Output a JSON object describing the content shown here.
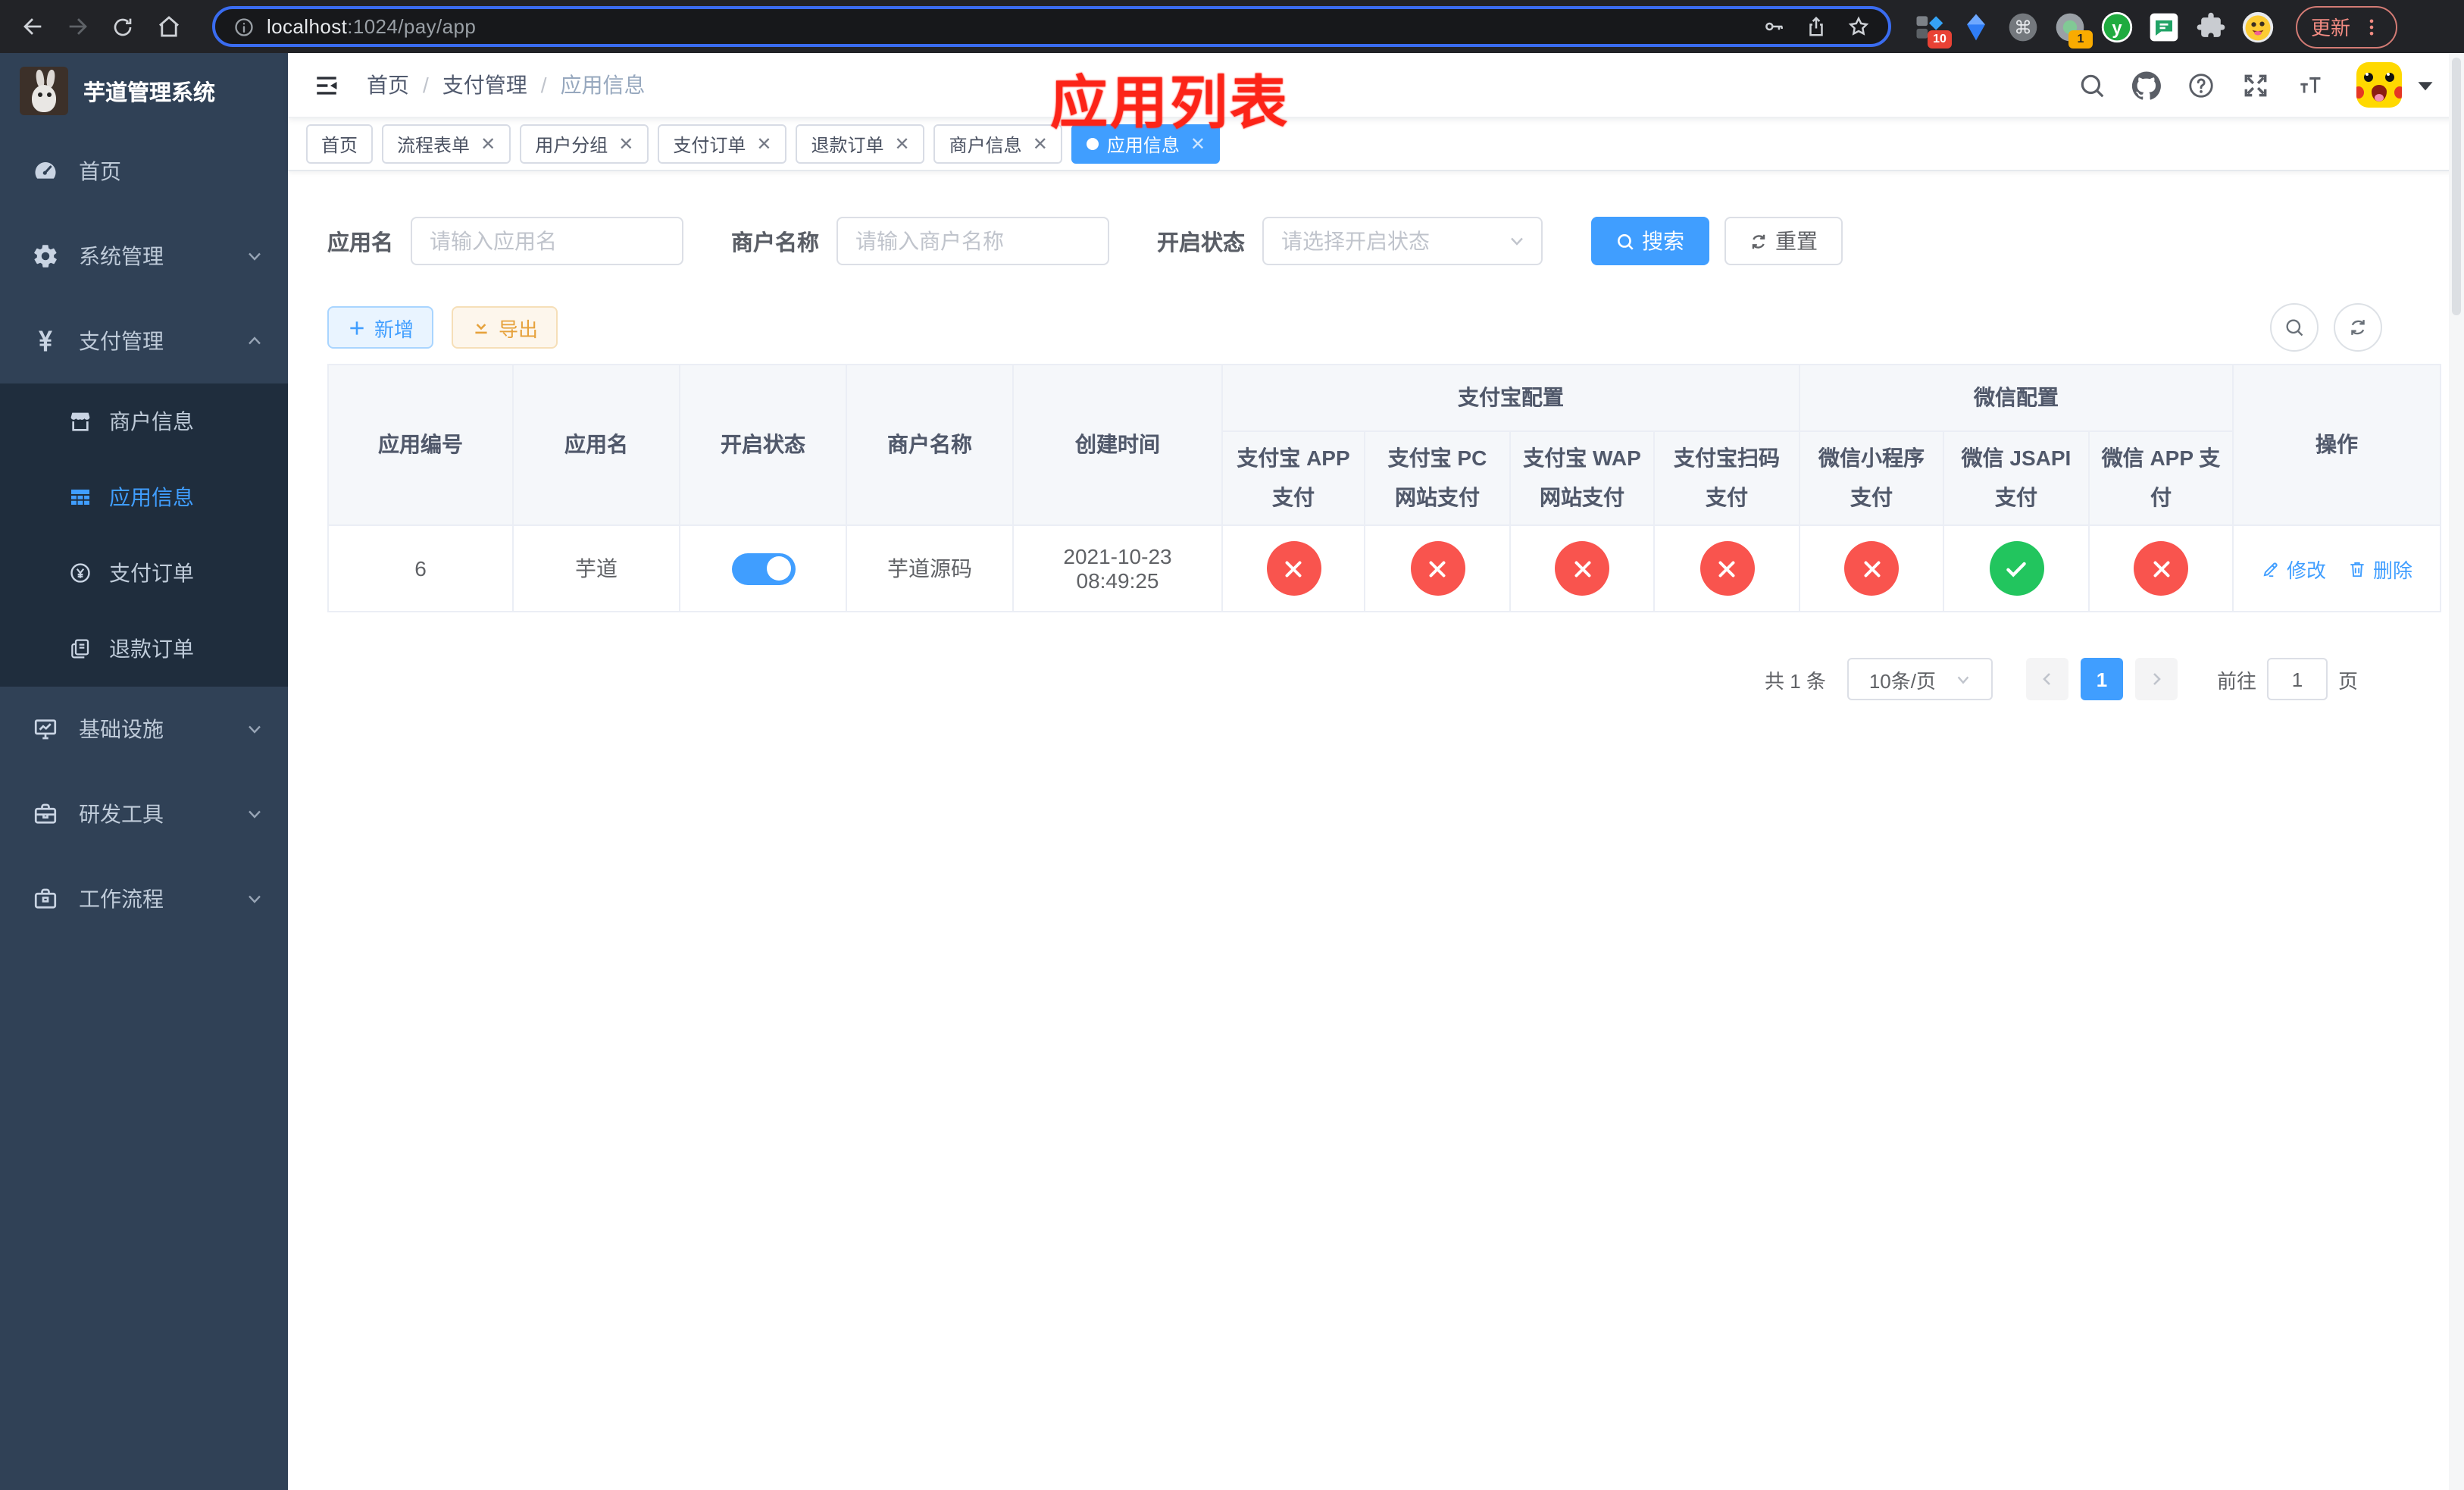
{
  "browser": {
    "url_host": "localhost",
    "url_rest": ":1024/pay/app",
    "update_label": "更新",
    "ext_badges": {
      "first": "10",
      "second": "1"
    },
    "ext5_letter": "y"
  },
  "sidebar": {
    "title": "芋道管理系统",
    "items": [
      {
        "label": "首页",
        "icon": "dashboard-icon"
      },
      {
        "label": "系统管理",
        "icon": "gear-icon",
        "chevron": "down"
      },
      {
        "label": "支付管理",
        "icon": "yen-icon",
        "chevron": "up",
        "expanded": true,
        "children": [
          {
            "label": "商户信息",
            "icon": "shop-icon"
          },
          {
            "label": "应用信息",
            "icon": "grid-icon",
            "active": true
          },
          {
            "label": "支付订单",
            "icon": "coin-icon"
          },
          {
            "label": "退款订单",
            "icon": "doc-icon"
          }
        ]
      },
      {
        "label": "基础设施",
        "icon": "monitor-icon",
        "chevron": "down"
      },
      {
        "label": "研发工具",
        "icon": "toolbox-icon",
        "chevron": "down"
      },
      {
        "label": "工作流程",
        "icon": "briefcase-icon",
        "chevron": "down"
      }
    ]
  },
  "navbar": {
    "breadcrumb": [
      "首页",
      "支付管理",
      "应用信息"
    ],
    "annotation": "应用列表"
  },
  "tags": [
    {
      "label": "首页",
      "closable": false,
      "active": false
    },
    {
      "label": "流程表单",
      "closable": true,
      "active": false
    },
    {
      "label": "用户分组",
      "closable": true,
      "active": false
    },
    {
      "label": "支付订单",
      "closable": true,
      "active": false
    },
    {
      "label": "退款订单",
      "closable": true,
      "active": false
    },
    {
      "label": "商户信息",
      "closable": true,
      "active": false
    },
    {
      "label": "应用信息",
      "closable": true,
      "active": true
    }
  ],
  "search": {
    "fields": [
      {
        "label": "应用名",
        "placeholder": "请输入应用名",
        "type": "input"
      },
      {
        "label": "商户名称",
        "placeholder": "请输入商户名称",
        "type": "input"
      },
      {
        "label": "开启状态",
        "placeholder": "请选择开启状态",
        "type": "select"
      }
    ],
    "search_label": "搜索",
    "reset_label": "重置"
  },
  "toolbar": {
    "add_label": "新增",
    "export_label": "导出"
  },
  "table": {
    "fixed_columns": [
      "应用编号",
      "应用名",
      "开启状态",
      "商户名称",
      "创建时间"
    ],
    "groups": [
      {
        "label": "支付宝配置",
        "children": [
          "支付宝 APP 支付",
          "支付宝 PC 网站支付",
          "支付宝 WAP 网站支付",
          "支付宝扫码支付"
        ]
      },
      {
        "label": "微信配置",
        "children": [
          "微信小程序支付",
          "微信 JSAPI 支付",
          "微信 APP 支付"
        ]
      }
    ],
    "op_label": "操作",
    "rows": [
      {
        "id": "6",
        "name": "芋道",
        "enabled": true,
        "merchant": "芋道源码",
        "created": "2021-10-23 08:49:25",
        "pay_status": [
          "no",
          "no",
          "no",
          "no",
          "no",
          "yes",
          "no"
        ],
        "edit_label": "修改",
        "delete_label": "删除"
      }
    ]
  },
  "pagination": {
    "total": "共 1 条",
    "page_size": "10条/页",
    "page": "1",
    "goto_prefix": "前往",
    "goto_value": "1",
    "goto_suffix": "页"
  },
  "colors": {
    "primary": "#409eff",
    "danger": "#f9544e",
    "success": "#22c55e",
    "sidebar": "#304156"
  }
}
